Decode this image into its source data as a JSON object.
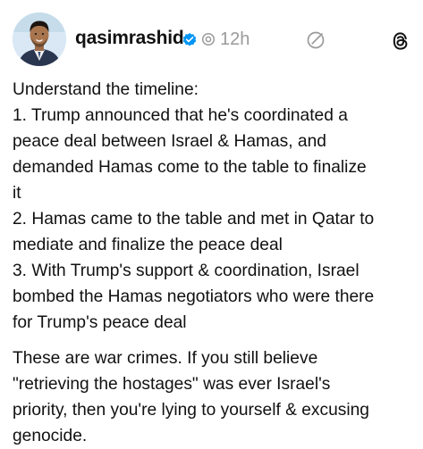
{
  "header": {
    "username": "qasimrashid",
    "timestamp": "12h",
    "icons": {
      "verified": "verified-badge-icon",
      "reposted": "repost-indicator-icon",
      "edit": "edit-icon",
      "logo": "threads-logo-icon"
    },
    "colors": {
      "verified_blue": "#0095f6",
      "muted_gray": "#9a9a9a"
    }
  },
  "post": {
    "paragraph1": [
      "Understand the timeline:",
      "1. Trump announced that he's coordinated a",
      "peace deal between Israel & Hamas, and",
      "demanded Hamas come to the table to finalize",
      "it",
      "2. Hamas came to the table and met in Qatar to",
      "mediate and finalize the peace deal",
      "3. With Trump's support & coordination, Israel",
      "bombed the Hamas negotiators who were there",
      "for Trump's peace deal"
    ],
    "paragraph2": [
      "These are war crimes. If you still believe",
      "\"retrieving the hostages\" was ever Israel's",
      "priority, then you're lying to yourself & excusing",
      "genocide."
    ]
  }
}
